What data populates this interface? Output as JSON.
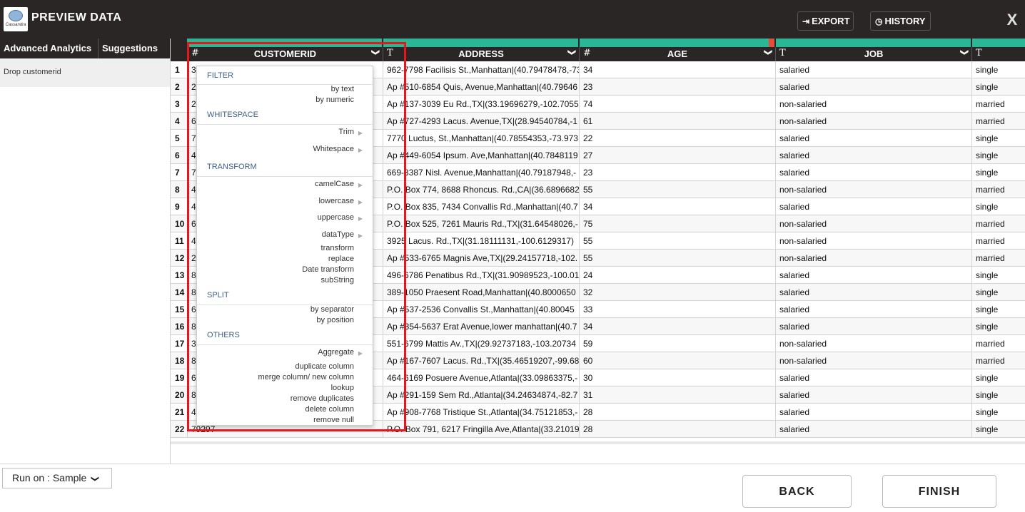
{
  "header": {
    "logo_text": "Cassandra",
    "title": "PREVIEW DATA",
    "export_label": "EXPORT",
    "history_label": "HISTORY",
    "close_label": "X"
  },
  "sidebar": {
    "tabs": [
      "Advanced Analytics",
      "Suggestions"
    ],
    "steps": [
      "Drop customerid"
    ]
  },
  "columns": [
    {
      "type": "#",
      "name": "CUSTOMERID"
    },
    {
      "type": "T",
      "name": "ADDRESS"
    },
    {
      "type": "#",
      "name": "AGE"
    },
    {
      "type": "T",
      "name": "JOB"
    },
    {
      "type": "T",
      "name": ""
    }
  ],
  "rows": [
    {
      "n": "1",
      "c1": "3",
      "c2": "962-7798 Facilisis St.,Manhattan|(40.79478478,-73",
      "c3": "34",
      "c4": "salaried",
      "c5": "single"
    },
    {
      "n": "2",
      "c1": "2",
      "c2": "Ap #510-6854 Quis, Avenue,Manhattan|(40.79646",
      "c3": "23",
      "c4": "salaried",
      "c5": "single"
    },
    {
      "n": "3",
      "c1": "2",
      "c2": "Ap #137-3039 Eu Rd.,TX|(33.19696279,-102.7055",
      "c3": "74",
      "c4": "non-salaried",
      "c5": "married"
    },
    {
      "n": "4",
      "c1": "6",
      "c2": "Ap #727-4293 Lacus. Avenue,TX|(28.94540784,-1",
      "c3": "61",
      "c4": "non-salaried",
      "c5": "married"
    },
    {
      "n": "5",
      "c1": "7",
      "c2": "7770 Luctus, St.,Manhattan|(40.78554353,-73.973",
      "c3": "22",
      "c4": "salaried",
      "c5": "single"
    },
    {
      "n": "6",
      "c1": "4",
      "c2": "Ap #449-6054 Ipsum. Ave,Manhattan|(40.7848119",
      "c3": "27",
      "c4": "salaried",
      "c5": "single"
    },
    {
      "n": "7",
      "c1": "7",
      "c2": "669-3387 Nisl. Avenue,Manhattan|(40.79187948,-",
      "c3": "23",
      "c4": "salaried",
      "c5": "single"
    },
    {
      "n": "8",
      "c1": "4",
      "c2": "P.O. Box 774, 8688 Rhoncus. Rd.,CA|(36.6896682",
      "c3": "55",
      "c4": "non-salaried",
      "c5": "married"
    },
    {
      "n": "9",
      "c1": "4",
      "c2": "P.O. Box 835, 7434 Convallis Rd.,Manhattan|(40.7",
      "c3": "34",
      "c4": "salaried",
      "c5": "single"
    },
    {
      "n": "10",
      "c1": "6",
      "c2": "P.O. Box 525, 7261 Mauris Rd.,TX|(31.64548026,-",
      "c3": "75",
      "c4": "non-salaried",
      "c5": "married"
    },
    {
      "n": "11",
      "c1": "4",
      "c2": "3925 Lacus. Rd.,TX|(31.18111131,-100.6129317)",
      "c3": "55",
      "c4": "non-salaried",
      "c5": "married"
    },
    {
      "n": "12",
      "c1": "2",
      "c2": "Ap #533-6765 Magnis Ave,TX|(29.24157718,-102.",
      "c3": "55",
      "c4": "non-salaried",
      "c5": "married"
    },
    {
      "n": "13",
      "c1": "8",
      "c2": "496-6786 Penatibus Rd.,TX|(31.90989523,-100.01",
      "c3": "24",
      "c4": "salaried",
      "c5": "single"
    },
    {
      "n": "14",
      "c1": "8",
      "c2": "389-1050 Praesent Road,Manhattan|(40.8000650",
      "c3": "32",
      "c4": "salaried",
      "c5": "single"
    },
    {
      "n": "15",
      "c1": "6",
      "c2": "Ap #537-2536 Convallis St.,Manhattan|(40.80045",
      "c3": "33",
      "c4": "salaried",
      "c5": "single"
    },
    {
      "n": "16",
      "c1": "8",
      "c2": "Ap #354-5637 Erat Avenue,lower manhattan|(40.7",
      "c3": "34",
      "c4": "salaried",
      "c5": "single"
    },
    {
      "n": "17",
      "c1": "3",
      "c2": "551-6799 Mattis Av.,TX|(29.92737183,-103.20734",
      "c3": "59",
      "c4": "non-salaried",
      "c5": "married"
    },
    {
      "n": "18",
      "c1": "8",
      "c2": "Ap #167-7607 Lacus. Rd.,TX|(35.46519207,-99.68",
      "c3": "60",
      "c4": "non-salaried",
      "c5": "married"
    },
    {
      "n": "19",
      "c1": "6",
      "c2": "464-6169 Posuere Avenue,Atlanta|(33.09863375,-",
      "c3": "30",
      "c4": "salaried",
      "c5": "single"
    },
    {
      "n": "20",
      "c1": "8",
      "c2": "Ap #291-159 Sem Rd.,Atlanta|(34.24634874,-82.7",
      "c3": "31",
      "c4": "salaried",
      "c5": "single"
    },
    {
      "n": "21",
      "c1": "4",
      "c2": "Ap #908-7768 Tristique St.,Atlanta|(34.75121853,-",
      "c3": "28",
      "c4": "salaried",
      "c5": "single"
    },
    {
      "n": "22",
      "c1": "79297",
      "c2": "P.O. Box 791, 6217 Fringilla Ave,Atlanta|(33.21019",
      "c3": "28",
      "c4": "salaried",
      "c5": "single"
    }
  ],
  "menu": {
    "filter": {
      "title": "FILTER",
      "items": [
        "by text",
        "by numeric"
      ]
    },
    "whitespace": {
      "title": "WHITESPACE",
      "items": [
        "Trim",
        "Whitespace"
      ]
    },
    "transform": {
      "title": "TRANSFORM",
      "items": [
        "camelCase",
        "lowercase",
        "uppercase",
        "dataType",
        "transform",
        "replace",
        "Date transform",
        "subString"
      ]
    },
    "split": {
      "title": "SPLIT",
      "items": [
        "by separator",
        "by position"
      ]
    },
    "others": {
      "title": "OTHERS",
      "items": [
        "Aggregate",
        "duplicate column",
        "merge column/ new column",
        "lookup",
        "remove duplicates",
        "delete column",
        "remove null"
      ]
    }
  },
  "footer": {
    "run_on_label": "Run on : Sample",
    "back_label": "BACK",
    "finish_label": "FINISH"
  },
  "colors": {
    "header_bg": "#2b2626",
    "bar_green": "#2bb795",
    "bar_red": "#e64c3c",
    "highlight_red": "#e8161c",
    "menu_section": "#3d5f86"
  }
}
